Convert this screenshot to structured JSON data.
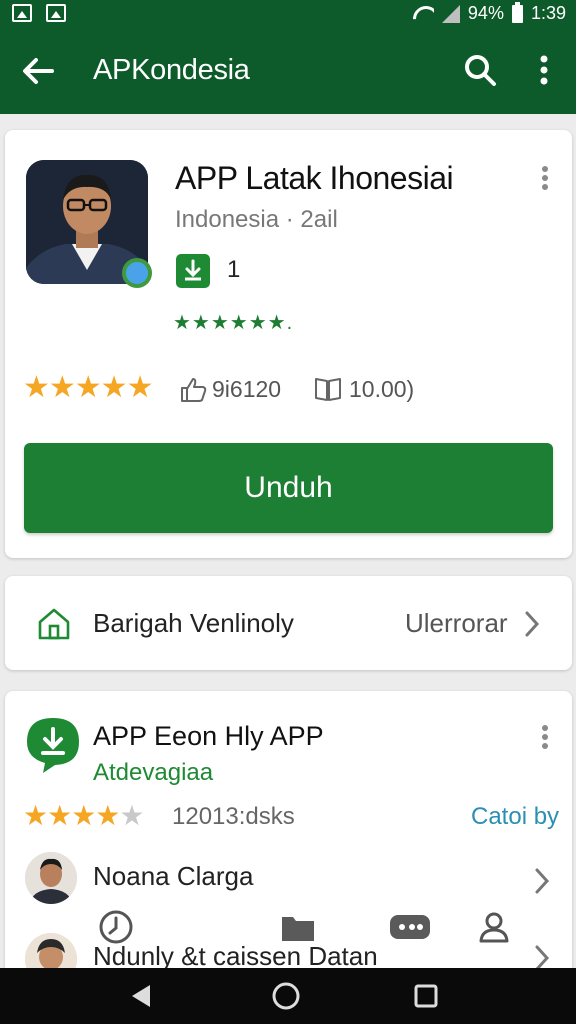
{
  "status_bar": {
    "battery": "94%",
    "time": "1:39"
  },
  "app_bar": {
    "title": "APKondesia"
  },
  "app_card": {
    "title": "APP Latak Ihonesiai",
    "subtitle": "Indonesia · 2ail",
    "download_count": "1",
    "mini_stars": "★★★★★★.",
    "rating_stars": "★★★★★",
    "likes": "9i6120",
    "reviews": "10.00)",
    "install_label": "Unduh"
  },
  "category_row": {
    "label": "Barigah Venlinoly",
    "right_label": "Ulerrorar"
  },
  "related_card": {
    "title": "APP Eeon Hly APP",
    "subtitle": "Atdevagiaa",
    "stars_filled": "★★★★",
    "stars_empty": "★",
    "reviews": "12013:dsks",
    "link": "Catoi by",
    "people": [
      {
        "name": "Noana Clarga"
      },
      {
        "name": "Ndunly &t caissen Datan"
      }
    ]
  },
  "colors": {
    "primary": "#0d5a2a",
    "accent_green": "#1d7f34",
    "star": "#f5a623",
    "link": "#2a8fb3"
  }
}
